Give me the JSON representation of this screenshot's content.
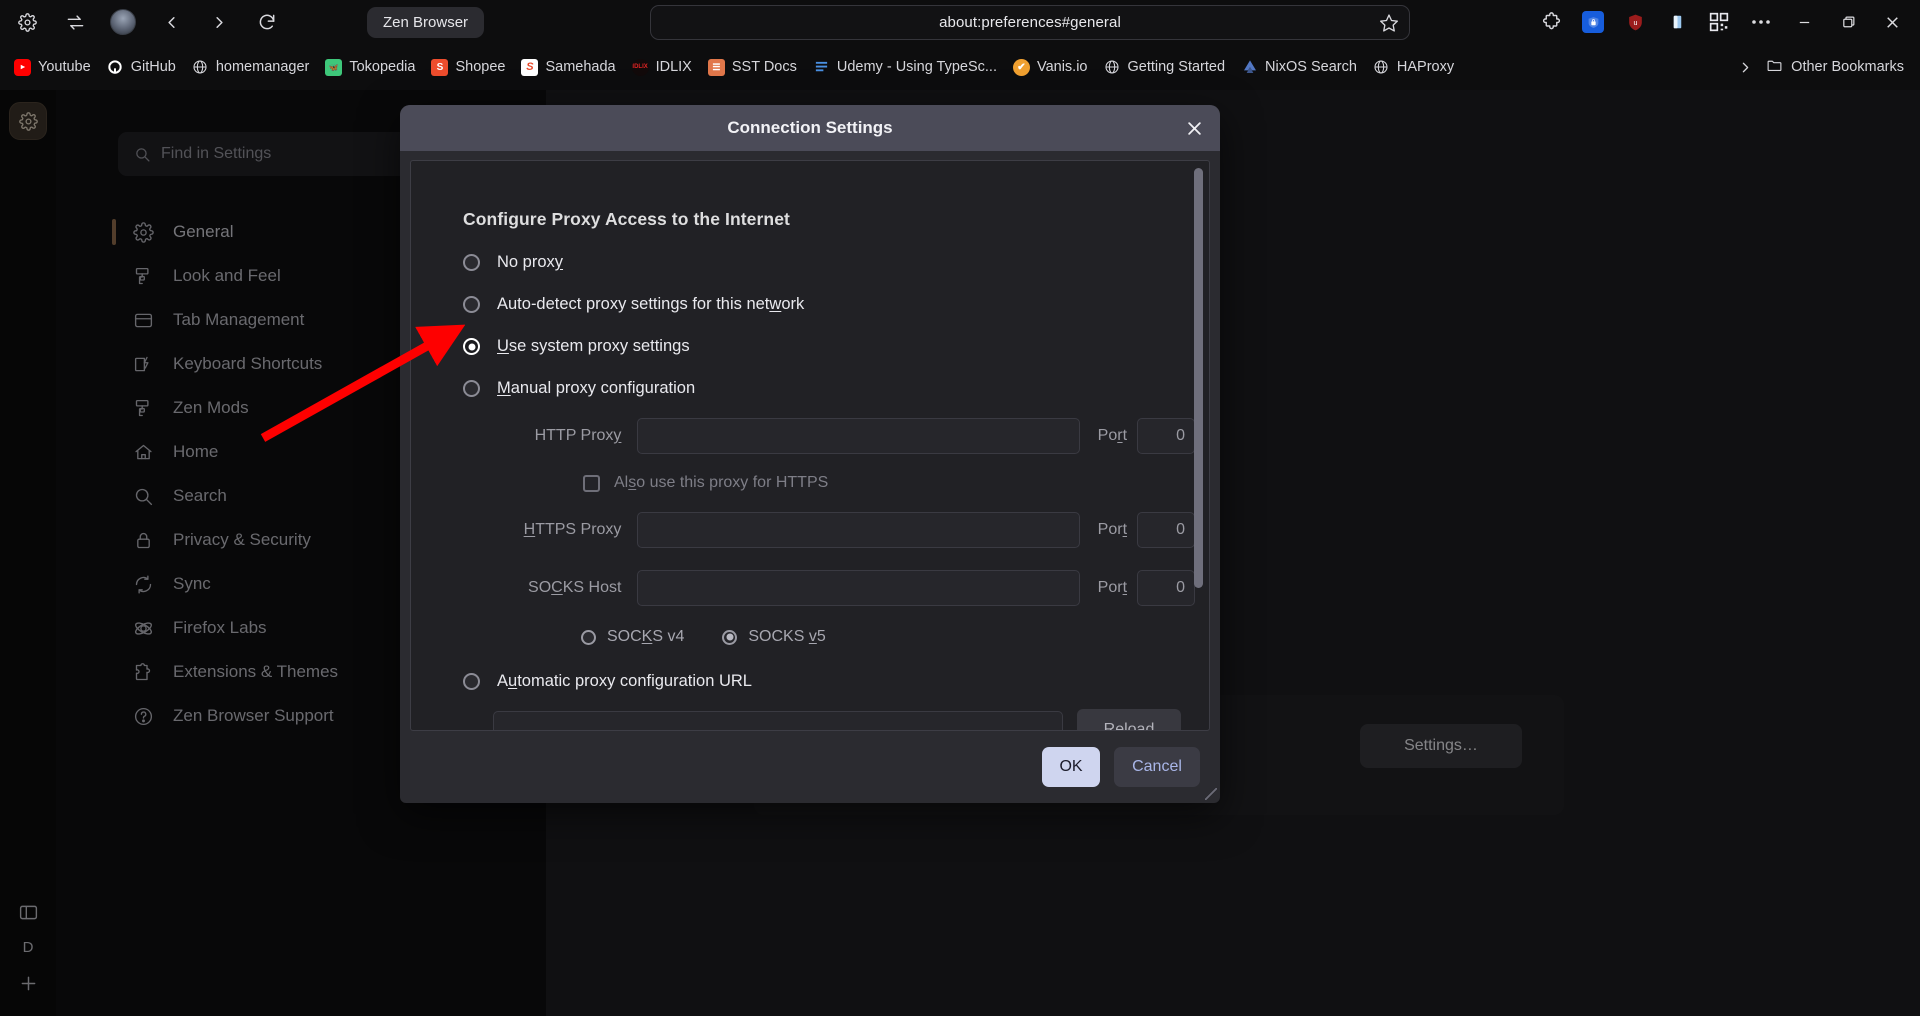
{
  "browser": {
    "title": "Zen Browser",
    "url": "about:preferences#general",
    "toolbar_icons": [
      "settings-gear-icon",
      "sync-arrows-icon",
      "profile-avatar-icon",
      "back-icon",
      "forward-icon",
      "reload-icon"
    ],
    "right_icons": [
      "extensions-puzzle-icon",
      "bitwarden-icon",
      "ublock-origin-icon",
      "reader-icon",
      "qr-code-icon",
      "more-options-icon"
    ],
    "window_controls": [
      "minimize",
      "restore",
      "close"
    ],
    "bookmarks": [
      {
        "label": "Youtube",
        "icon": "youtube-icon",
        "color": "#ff0000"
      },
      {
        "label": "GitHub",
        "icon": "github-icon",
        "color": "#ffffff"
      },
      {
        "label": "homemanager",
        "icon": "globe-icon",
        "color": "#d8d8dd"
      },
      {
        "label": "Tokopedia",
        "icon": "tokopedia-icon",
        "color": "#3ec77a"
      },
      {
        "label": "Shopee",
        "icon": "shopee-icon",
        "color": "#ee4d2d"
      },
      {
        "label": "Samehada",
        "icon": "samehada-icon",
        "color": "#e8492b"
      },
      {
        "label": "IDLIX",
        "icon": "idlix-icon",
        "color": "#c20d0d"
      },
      {
        "label": "SST Docs",
        "icon": "sst-docs-icon",
        "color": "#e1774a"
      },
      {
        "label": "Udemy - Using TypeSc...",
        "icon": "udemy-icon",
        "color": "#4a90e2"
      },
      {
        "label": "Vanis.io",
        "icon": "vanis-icon",
        "color": "#f0a030"
      },
      {
        "label": "Getting Started",
        "icon": "globe-icon",
        "color": "#d8d8dd"
      },
      {
        "label": "NixOS Search",
        "icon": "nixos-icon",
        "color": "#5277c3"
      },
      {
        "label": "HAProxy",
        "icon": "globe-icon",
        "color": "#d8d8dd"
      }
    ],
    "overflow_label": "›",
    "other_bookmarks": "Other Bookmarks"
  },
  "zen_strip": {
    "workspace_icon": "gear-icon",
    "bottom_icons": [
      "sidebar-panel-icon"
    ],
    "profile_letter": "D",
    "new_tab_icon": "plus-icon"
  },
  "preferences": {
    "search": {
      "placeholder": "Find in Settings",
      "icon": "search-icon"
    },
    "nav_items": [
      {
        "label": "General",
        "icon": "gear-icon",
        "selected": true
      },
      {
        "label": "Look and Feel",
        "icon": "paint-roller-icon",
        "selected": false
      },
      {
        "label": "Tab Management",
        "icon": "tabs-icon",
        "selected": false
      },
      {
        "label": "Keyboard Shortcuts",
        "icon": "keyboard-shortcut-icon",
        "selected": false
      },
      {
        "label": "Zen Mods",
        "icon": "paint-roller-icon",
        "selected": false
      },
      {
        "label": "Home",
        "icon": "home-icon",
        "selected": false
      },
      {
        "label": "Search",
        "icon": "search-icon",
        "selected": false
      },
      {
        "label": "Privacy & Security",
        "icon": "lock-icon",
        "selected": false
      },
      {
        "label": "Sync",
        "icon": "sync-icon",
        "selected": false
      },
      {
        "label": "Firefox Labs",
        "icon": "atom-icon",
        "selected": false
      },
      {
        "label": "Extensions & Themes",
        "icon": "puzzle-piece-icon",
        "selected": false
      },
      {
        "label": "Zen Browser Support",
        "icon": "question-circle-icon",
        "selected": false
      }
    ],
    "settings_button": "Settings…"
  },
  "dialog": {
    "title": "Connection Settings",
    "close_icon": "close-icon",
    "heading": "Configure Proxy Access to the Internet",
    "proxy_options": [
      {
        "label": "No proxy",
        "accesskey": "y",
        "selected": false
      },
      {
        "label": "Auto-detect proxy settings for this network",
        "accesskey": "w",
        "selected": false
      },
      {
        "label": "Use system proxy settings",
        "accesskey": "U",
        "selected": true
      },
      {
        "label": "Manual proxy configuration",
        "accesskey": "M",
        "selected": false
      }
    ],
    "fields": {
      "http_proxy_label": "HTTP Proxy",
      "http_proxy_value": "",
      "http_port_label": "Port",
      "http_port_value": "0",
      "also_https_label": "Also use this proxy for HTTPS",
      "also_https_checked": false,
      "https_proxy_label": "HTTPS Proxy",
      "https_proxy_value": "",
      "https_port_label": "Port",
      "https_port_value": "0",
      "socks_host_label": "SOCKS Host",
      "socks_host_value": "",
      "socks_port_label": "Port",
      "socks_port_value": "0"
    },
    "socks_versions": [
      {
        "label": "SOCKS v4",
        "selected": false
      },
      {
        "label": "SOCKS v5",
        "selected": true
      }
    ],
    "pac": {
      "label": "Automatic proxy configuration URL",
      "value": "",
      "reload_label": "Reload",
      "selected": false
    },
    "buttons": {
      "ok": "OK",
      "cancel": "Cancel"
    }
  },
  "annotation": {
    "type": "arrow",
    "color": "#fe0000",
    "points_to": "Use system proxy settings radio"
  }
}
